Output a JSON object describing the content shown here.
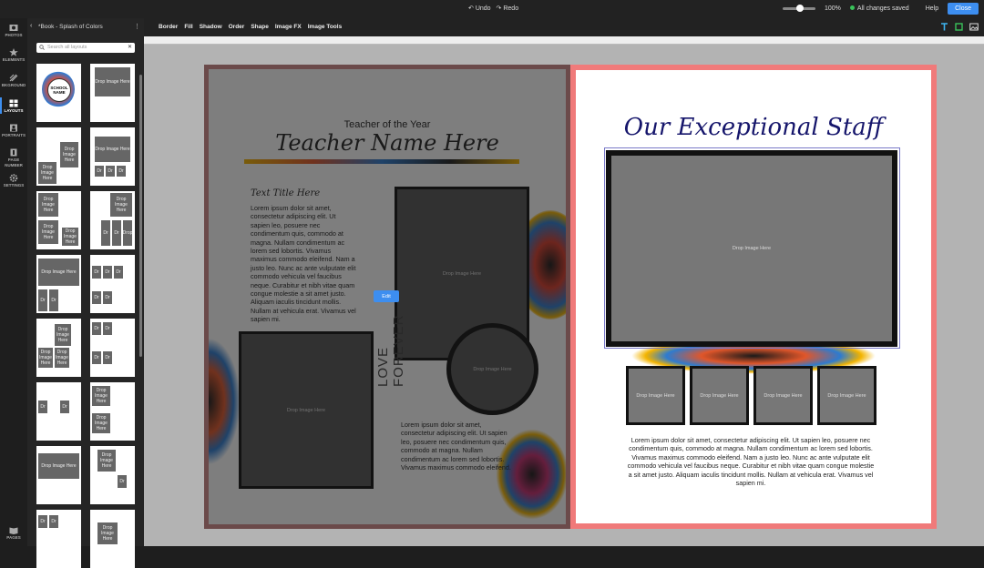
{
  "topbar": {
    "undo": "Undo",
    "redo": "Redo",
    "zoom": "100%",
    "save_status": "All changes saved",
    "help": "Help",
    "close": "Close",
    "zoom_level": 0.55
  },
  "rail": [
    {
      "id": "photos",
      "label": "PHOTOS"
    },
    {
      "id": "elements",
      "label": "ELEMENTS"
    },
    {
      "id": "background",
      "label": "BKGROUND"
    },
    {
      "id": "layouts",
      "label": "LAYOUTS"
    },
    {
      "id": "portraits",
      "label": "PORTRAITS"
    },
    {
      "id": "page-number",
      "label": "PAGE NUMBER"
    },
    {
      "id": "settings",
      "label": "SETTINGS"
    },
    {
      "id": "pages",
      "label": "PAGES"
    }
  ],
  "panel": {
    "title": "*Book - Splash of Colors",
    "search_placeholder": "Search all layouts",
    "school_name": "SCHOOL NAME",
    "ph_drop": "Drop Image Here",
    "ph_short": "Drop Image Here",
    "ph_dr": "Dr",
    "ph_drop_word": "Drop"
  },
  "toolbar": {
    "tabs": [
      "Border",
      "Fill",
      "Shadow",
      "Order",
      "Shape",
      "Image FX",
      "Image Tools"
    ]
  },
  "left_page": {
    "subtitle": "Teacher of the Year",
    "title": "Teacher Name Here",
    "text_title": "Text Title Here",
    "body1": "Lorem ipsum dolor sit amet, consectetur adipiscing elit. Ut sapien leo, posuere nec condimentum quis, commodo at magna. Nullam condimentum ac lorem sed lobortis. Vivamus maximus commodo eleifend. Nam a justo leo. Nunc ac ante vulputate elit commodo vehicula vel faucibus neque. Curabitur et nibh vitae quam congue molestie a sit amet justo. Aliquam iaculis tincidunt mollis. Nullam at vehicula erat. Vivamus vel sapien mi.",
    "body2": "Lorem ipsum dolor sit amet, consectetur adipiscing elit. Ut sapien leo, posuere nec condimentum quis, commodo at magna. Nullam condimentum ac lorem sed lobortis. Vivamus maximus commodo eleifend.",
    "vertical": "LOVE FOREVER",
    "drop": "Drop Image Here",
    "edit": "Edit"
  },
  "right_page": {
    "title": "Our Exceptional Staff",
    "drop": "Drop Image Here",
    "body": "Lorem ipsum dolor sit amet, consectetur adipiscing elit. Ut sapien leo, posuere nec condimentum quis, commodo at magna. Nullam condimentum ac lorem sed lobortis. Vivamus maximus commodo eleifend. Nam a justo leo. Nunc ac ante vulputate elit commodo vehicula vel faucibus neque. Curabitur et nibh vitae quam congue molestie a sit amet justo. Aliquam iaculis tincidunt mollis. Nullam at vehicula erat. Vivamus vel sapien mi."
  },
  "colors": {
    "accent": "#3d8ef0",
    "right_frame": "#f07a7a",
    "left_frame": "#6b4a4a",
    "title_ink": "#15156b"
  }
}
